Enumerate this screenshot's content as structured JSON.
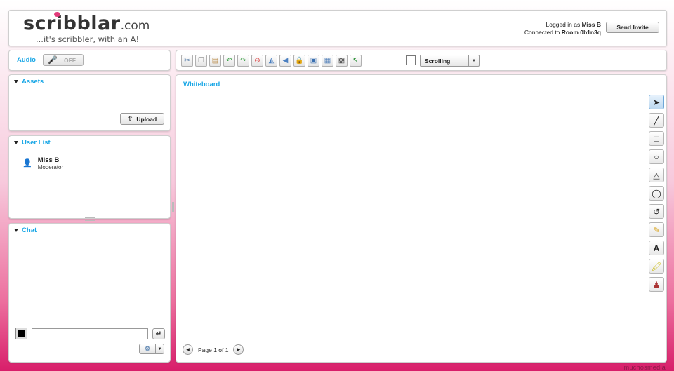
{
  "header": {
    "logo_main": "scribblar",
    "logo_tld": ".com",
    "tagline": "...it's scribbler, with an A!",
    "logged_in_prefix": "Logged in as",
    "logged_in_user": "Miss B",
    "connected_prefix": "Connected to",
    "room": "Room 0b1n3q",
    "send_invite_label": "Send Invite"
  },
  "audio": {
    "label": "Audio",
    "toggle_label": "OFF"
  },
  "assets": {
    "title": "Assets",
    "upload_label": "Upload"
  },
  "user_list": {
    "title": "User List",
    "users": [
      {
        "name": "Miss B",
        "role": "Moderator"
      }
    ]
  },
  "chat": {
    "title": "Chat",
    "input_value": "",
    "text_color": "#000000"
  },
  "toolbar": {
    "icons": [
      "cut-icon",
      "copy-icon",
      "paste-icon",
      "undo-icon",
      "redo-icon",
      "delete-icon",
      "flip-icon",
      "back-icon",
      "lock-icon",
      "import-icon",
      "export-icon",
      "snapshot-icon",
      "pointer-icon"
    ],
    "scroll_mode": "Scrolling"
  },
  "whiteboard": {
    "title": "Whiteboard",
    "page_label": "Page 1 of 1",
    "tools": [
      "select-tool",
      "line-tool",
      "rectangle-tool",
      "circle-tool",
      "triangle-tool",
      "ellipse-tool",
      "arc-tool",
      "pencil-tool",
      "text-tool",
      "highlighter-tool",
      "stamp-tool"
    ]
  },
  "footer": {
    "brand": "muchosmedia"
  },
  "colors": {
    "accent": "#1aa7e6",
    "brand_pink": "#d81e6a"
  }
}
